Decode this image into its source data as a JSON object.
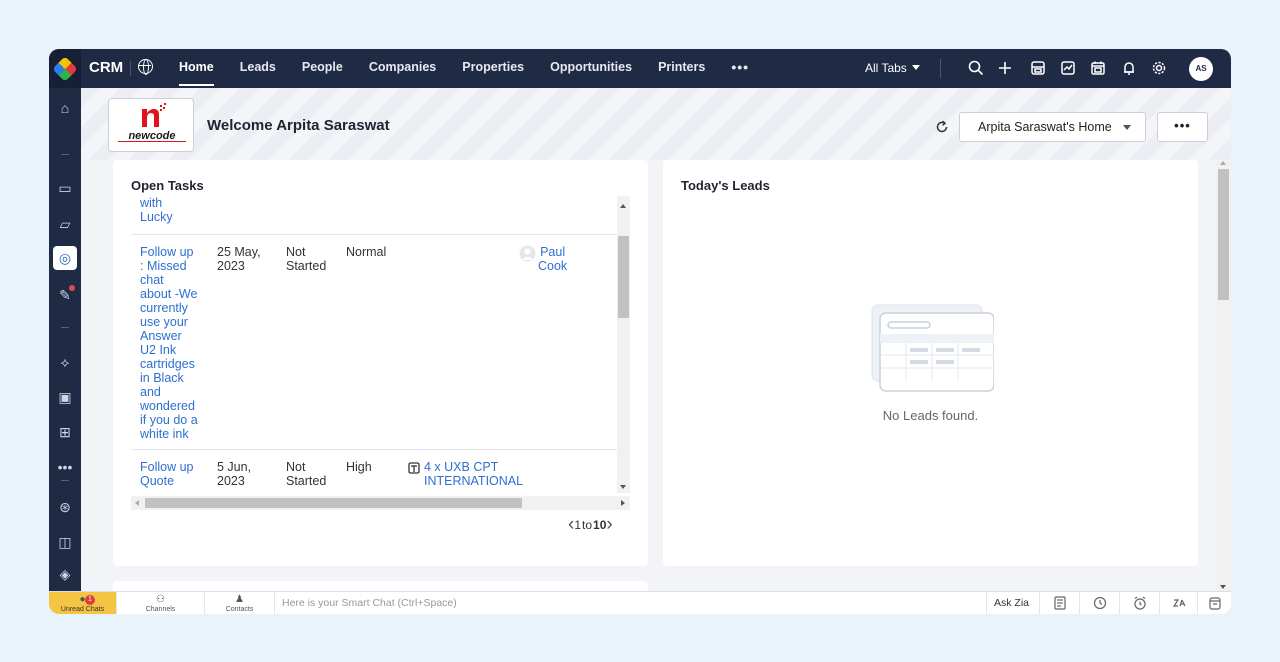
{
  "app": {
    "name": "CRM"
  },
  "topnav": {
    "tabs": [
      "Home",
      "Leads",
      "People",
      "Companies",
      "Properties",
      "Opportunities",
      "Printers"
    ],
    "more": "•••",
    "all_tabs": "All Tabs",
    "avatar_initials": "AS"
  },
  "header": {
    "welcome": "Welcome Arpita Saraswat",
    "home_select": "Arpita Saraswat's Home",
    "more_label": "•••",
    "logo_text": "newcode"
  },
  "open_tasks": {
    "title": "Open Tasks",
    "rows": [
      {
        "subject_lines": [
          "with",
          "Lucky"
        ],
        "date_lines": [],
        "status_lines": [],
        "priority": "",
        "related_lines": [],
        "owner_lines": []
      },
      {
        "subject_lines": [
          "Follow up",
          ": Missed",
          "chat",
          "about -We",
          "currently",
          "use your",
          "Answer",
          "U2 Ink",
          "cartridges",
          "in Black",
          "and",
          "wondered",
          "if you do a",
          "white ink"
        ],
        "date_lines": [
          "25 May,",
          "2023"
        ],
        "status_lines": [
          "Not",
          "Started"
        ],
        "priority": "Normal",
        "related_lines": [],
        "owner_lines": [
          "Paul",
          "Cook"
        ]
      },
      {
        "subject_lines": [
          "Follow up",
          "Quote"
        ],
        "date_lines": [
          "5 Jun,",
          "2023"
        ],
        "status_lines": [
          "Not",
          "Started"
        ],
        "priority": "High",
        "related_lines": [
          "4 x UXB CPT",
          "INTERNATIONAL"
        ],
        "owner_lines": []
      }
    ],
    "pager": {
      "from": "1",
      "to_label": "to",
      "to": "10"
    }
  },
  "todays_leads": {
    "title": "Today's Leads",
    "empty_text": "No Leads found."
  },
  "bottombar": {
    "unread_label": "Unread Chats",
    "unread_count": "1",
    "channels": "Channels",
    "contacts": "Contacts",
    "smart_chat": "Here is your Smart Chat (Ctrl+Space)",
    "ask_zia": "Ask Zia"
  },
  "colors": {
    "nav": "#1f2a44",
    "link": "#2f6fd0",
    "unread": "#f4c542"
  }
}
